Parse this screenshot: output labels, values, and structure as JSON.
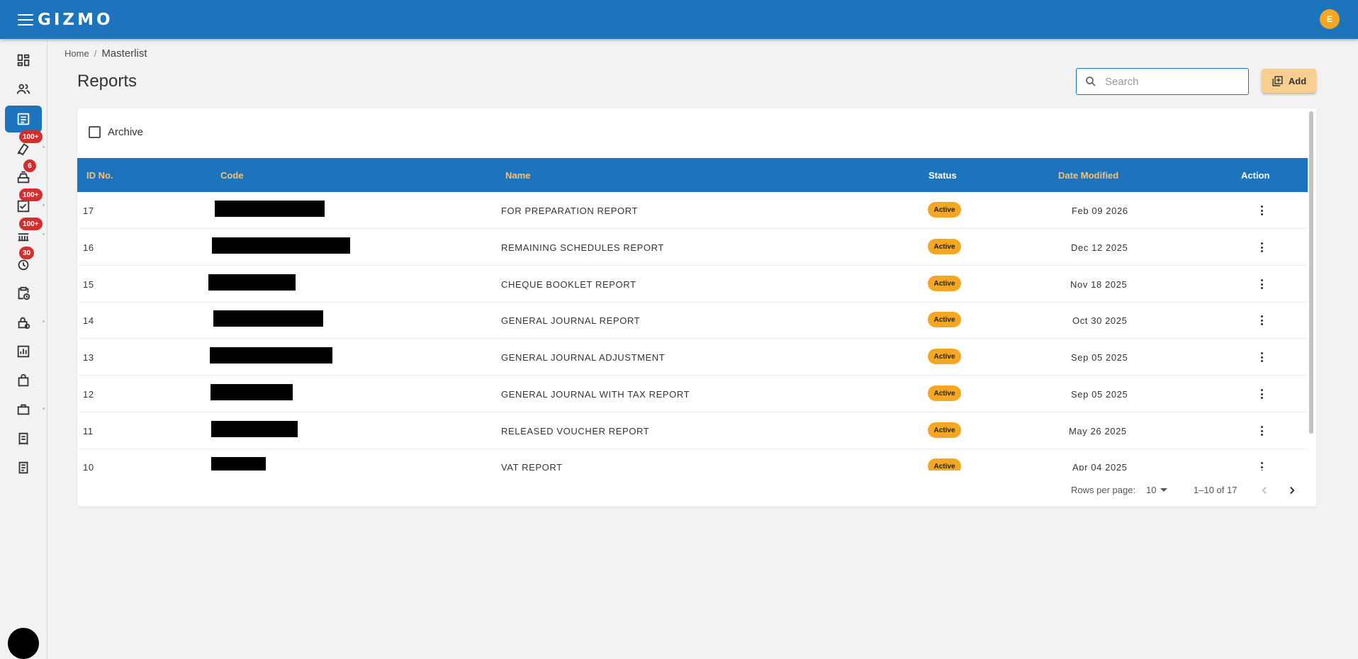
{
  "app": {
    "logo": "GIZMO",
    "user_initial": "E"
  },
  "colors": {
    "primary": "#1c75bc",
    "accent": "#f5a623",
    "header_text": "#f8c06f",
    "badge": "#d32f2f"
  },
  "sidebar": {
    "items": [
      {
        "icon": "dashboard-icon",
        "badge": ""
      },
      {
        "icon": "users-icon",
        "badge": ""
      },
      {
        "icon": "list-icon",
        "badge": "",
        "active": true
      },
      {
        "icon": "voucher-icon",
        "badge": "100+"
      },
      {
        "icon": "cash-register-icon",
        "badge": "6"
      },
      {
        "icon": "checked-document-icon",
        "badge": "100+"
      },
      {
        "icon": "queue-icon",
        "badge": "100+"
      },
      {
        "icon": "history-icon",
        "badge": "30"
      },
      {
        "icon": "clipboard-clock-icon",
        "badge": ""
      },
      {
        "icon": "lock-icon",
        "badge": ""
      },
      {
        "icon": "bar-chart-icon",
        "badge": ""
      },
      {
        "icon": "shopping-bag-icon",
        "badge": ""
      },
      {
        "icon": "briefcase-icon",
        "badge": ""
      },
      {
        "icon": "receipt-icon",
        "badge": ""
      },
      {
        "icon": "receipt-long-icon",
        "badge": ""
      }
    ]
  },
  "breadcrumb": {
    "home": "Home",
    "separator": "/",
    "current": "Masterlist"
  },
  "page": {
    "title": "Reports"
  },
  "search": {
    "placeholder": "Search"
  },
  "toolbar": {
    "add_label": "Add"
  },
  "filters": {
    "archive_label": "Archive",
    "archive_checked": false
  },
  "table": {
    "columns": {
      "id": "ID No.",
      "code": "Code",
      "name": "Name",
      "status": "Status",
      "date": "Date Modified",
      "action": "Action"
    },
    "rows": [
      {
        "id": "17",
        "name": "FOR PREPARATION REPORT",
        "status": "Active",
        "date": "Feb 09 2026"
      },
      {
        "id": "16",
        "name": "REMAINING SCHEDULES REPORT",
        "status": "Active",
        "date": "Dec 12 2025"
      },
      {
        "id": "15",
        "name": "CHEQUE BOOKLET REPORT",
        "status": "Active",
        "date": "Nov 18 2025"
      },
      {
        "id": "14",
        "name": "GENERAL JOURNAL REPORT",
        "status": "Active",
        "date": "Oct 30 2025"
      },
      {
        "id": "13",
        "name": "GENERAL JOURNAL ADJUSTMENT",
        "status": "Active",
        "date": "Sep 05 2025"
      },
      {
        "id": "12",
        "name": "GENERAL JOURNAL WITH TAX REPORT",
        "status": "Active",
        "date": "Sep 05 2025"
      },
      {
        "id": "11",
        "name": "RELEASED VOUCHER REPORT",
        "status": "Active",
        "date": "May 26 2025"
      },
      {
        "id": "10",
        "name": "VAT REPORT",
        "status": "Active",
        "date": "Apr 04 2025"
      }
    ]
  },
  "pagination": {
    "rows_label": "Rows per page:",
    "rows_value": "10",
    "range": "1–10 of 17"
  }
}
